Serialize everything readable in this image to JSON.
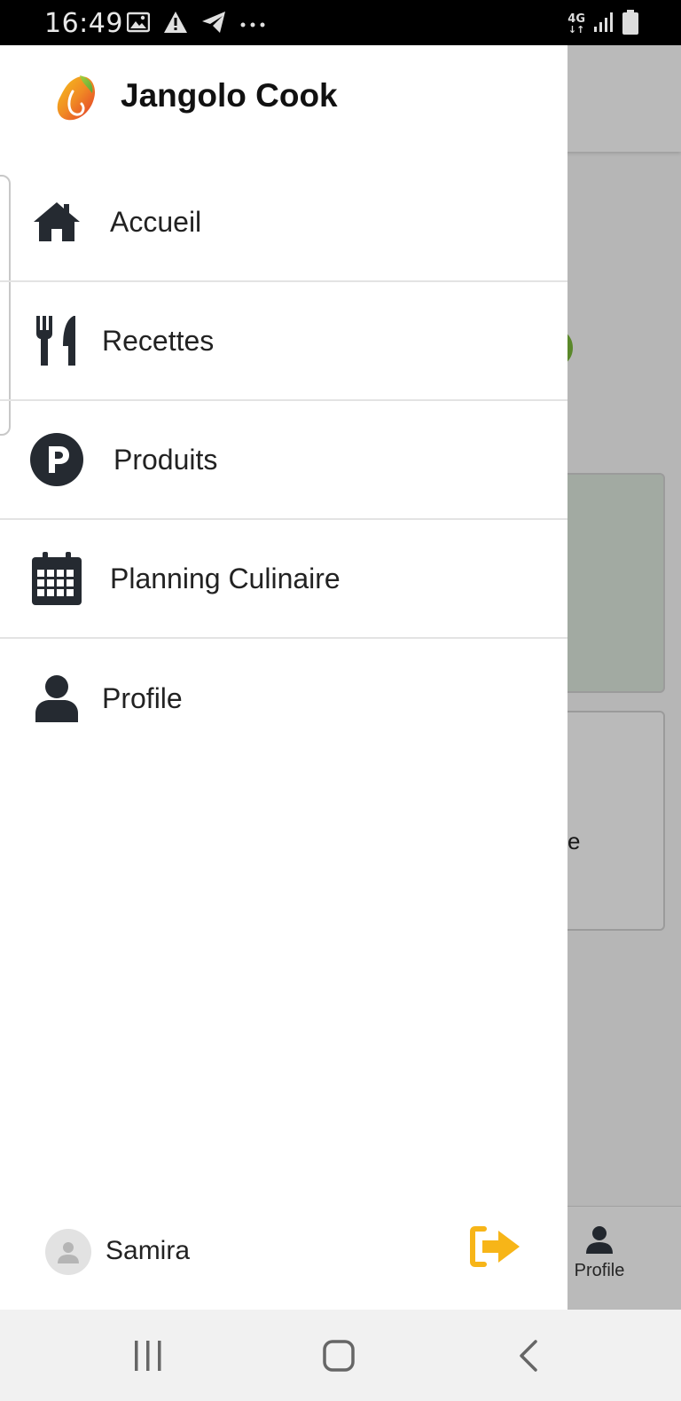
{
  "status_bar": {
    "time": "16:49",
    "left_icons": [
      "image-icon",
      "warning-icon",
      "telegram-icon",
      "more-dots-icon"
    ],
    "network_label": "4G",
    "right_icons": [
      "network-4g-icon",
      "signal-icon",
      "battery-icon"
    ]
  },
  "drawer": {
    "app_title": "Jangolo Cook",
    "items": [
      {
        "label": "Accueil",
        "icon": "home-icon"
      },
      {
        "label": "Recettes",
        "icon": "utensils-icon"
      },
      {
        "label": "Produits",
        "icon": "product-p-icon"
      },
      {
        "label": "Planning Culinaire",
        "icon": "calendar-icon"
      },
      {
        "label": "Profile",
        "icon": "user-icon"
      }
    ],
    "footer": {
      "user_name": "Samira",
      "logout_icon": "logout-icon"
    }
  },
  "background": {
    "card_text_fragment": "e",
    "bottom_nav_profile_label": "Profile"
  },
  "colors": {
    "accent_logout": "#f7b518",
    "scrim": "rgba(0,0,0,0.27)",
    "icon_dark": "#252a31"
  },
  "android_nav": [
    "recent-apps-icon",
    "home-button-icon",
    "back-icon"
  ]
}
